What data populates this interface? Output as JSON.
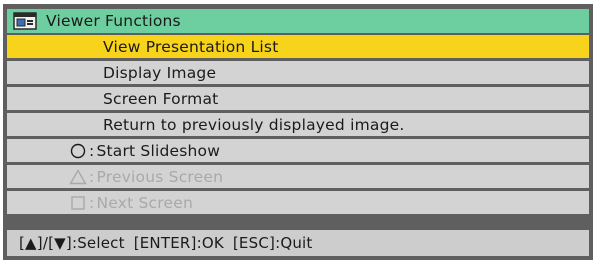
{
  "window": {
    "title": "Viewer Functions",
    "icon": "viewer-monitor-icon"
  },
  "menu": {
    "items": [
      {
        "label": "View Presentation List",
        "selected": true
      },
      {
        "label": "Display Image",
        "selected": false
      },
      {
        "label": "Screen Format",
        "selected": false
      },
      {
        "label": "Return to previously displayed image.",
        "selected": false
      }
    ]
  },
  "actions": [
    {
      "symbol": "circle-icon",
      "key": "○",
      "label": "Start Slideshow",
      "enabled": true
    },
    {
      "symbol": "triangle-icon",
      "key": "△",
      "label": "Previous Screen",
      "enabled": false
    },
    {
      "symbol": "square-icon",
      "key": "□",
      "label": "Next Screen",
      "enabled": false
    }
  ],
  "footer": {
    "nav_keys": "[▲]/[▼]",
    "nav_label": "Select",
    "enter_key": "[ENTER]",
    "enter_label": "OK",
    "esc_key": "[ESC]",
    "esc_label": "Quit"
  },
  "colors": {
    "titlebar": "#6dcea0",
    "selected": "#f7d31c",
    "row": "#d3d3d3",
    "frame": "#5f5f5f",
    "disabled_text": "#a9a9a9"
  }
}
